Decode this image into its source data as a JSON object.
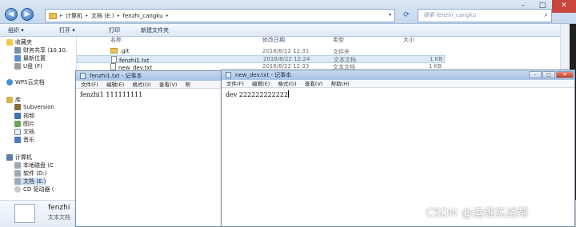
{
  "explorer": {
    "breadcrumbs": [
      "计算机",
      "文档 (E:)",
      "fenzhi_cangku"
    ],
    "search_placeholder": "搜索 fenzhi_cangku",
    "toolbar": [
      "组织 ▾",
      "打开 ▾",
      "打印",
      "新建文件夹"
    ],
    "sidebar": {
      "favorites": [
        "收藏夹",
        "财务共享 (10.10.",
        "最新位置",
        "U盘 (F)"
      ],
      "wps": "WPS云文档",
      "libraries": [
        "库",
        "Subversion",
        "视频",
        "图片",
        "文档",
        "音乐"
      ],
      "computer": [
        "计算机",
        "本地磁盘 (C",
        "软件 (D:)",
        "文档 (E:)",
        "CD 驱动器 ("
      ]
    },
    "columns": [
      "名称",
      "修改日期",
      "类型",
      "大小"
    ],
    "files": [
      {
        "name": ".git",
        "date": "2018/8/22 12:31",
        "type": "文件夹",
        "size": ""
      },
      {
        "name": "fenzhi1.txt",
        "date": "2018/8/22 12:24",
        "type": "文本文档",
        "size": "1 KB"
      },
      {
        "name": "new_dev.txt",
        "date": "2018/8/22 12:33",
        "type": "文本文档",
        "size": "1 KB"
      }
    ],
    "details": {
      "name": "fenzhi",
      "type": "文本文档"
    }
  },
  "notepad1": {
    "title": "fenzhi1.txt - 记事本",
    "menu": [
      "文件(F)",
      "编辑(E)",
      "格式(O)",
      "查看(V)",
      "帮"
    ],
    "content": "fenzhi1 111111111"
  },
  "notepad2": {
    "title": "new_dev.txt - 记事本",
    "menu": [
      "文件(F)",
      "编辑(E)",
      "格式(O)",
      "查看(V)",
      "帮助(H)"
    ],
    "content": "dev 222222222222"
  },
  "watermark": "CSDN @运维实战帮"
}
